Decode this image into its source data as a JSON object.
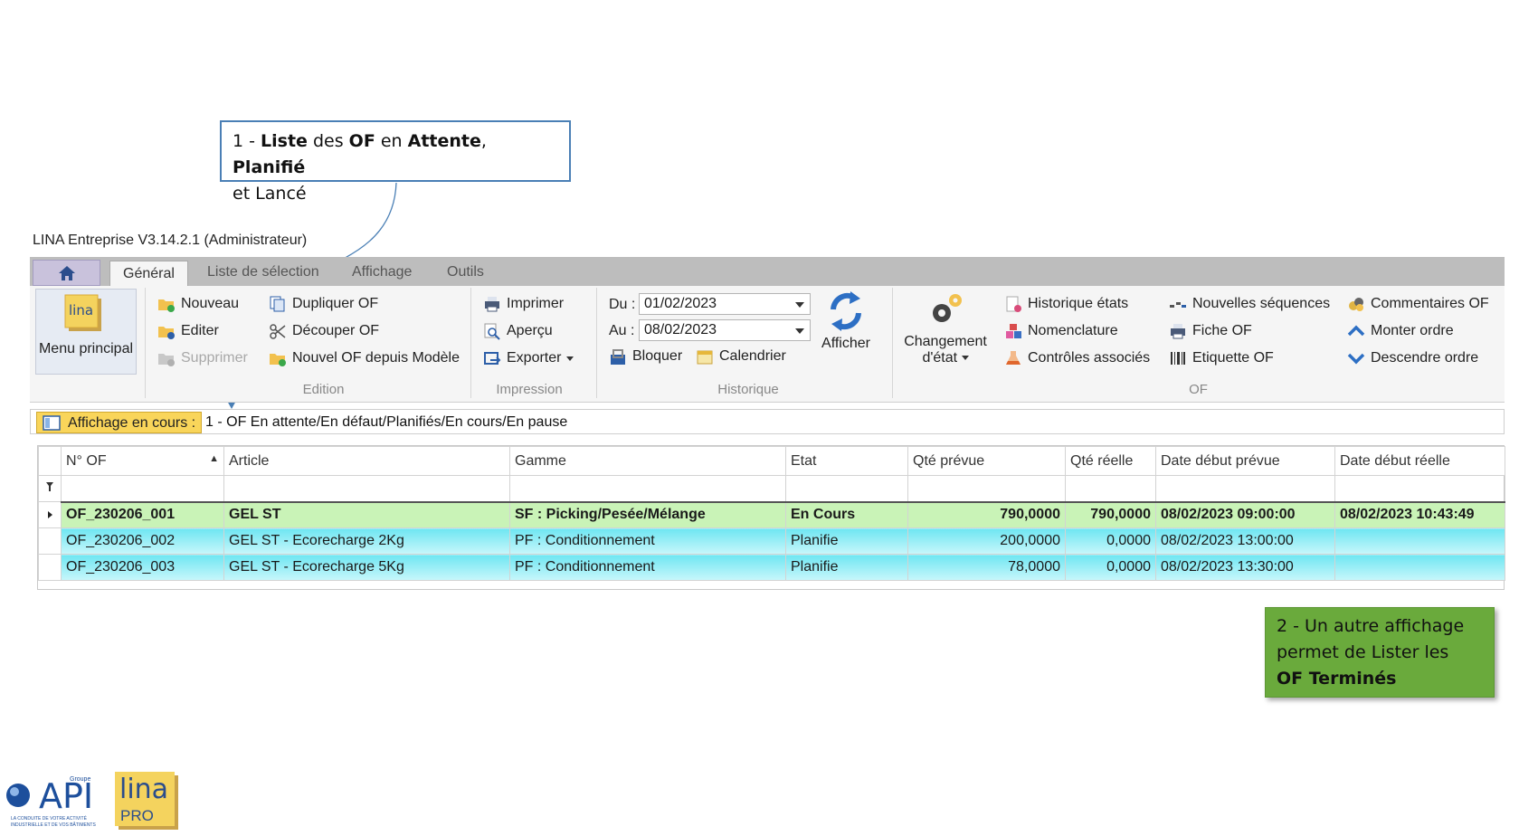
{
  "callout1": {
    "num": "1 - ",
    "w1": "Liste",
    "w2": " des ",
    "w3": "OF",
    "w4": " en ",
    "w5": "Attente",
    "w6": ", ",
    "w7": "Planifié",
    "w8": "et Lancé"
  },
  "callout2": {
    "line1": "2 - Un autre affichage",
    "line2": "permet de Lister les",
    "line3": "OF Terminés"
  },
  "window": {
    "title": "LINA Entreprise  V3.14.2.1  (Administrateur)"
  },
  "tabs": [
    "Général",
    "Liste de sélection",
    "Affichage",
    "Outils"
  ],
  "ribbon": {
    "menu_principal": "Menu principal",
    "edition": {
      "label": "Edition",
      "nouveau": "Nouveau",
      "editer": "Editer",
      "supprimer": "Supprimer",
      "dupliquer": "Dupliquer OF",
      "decouper": "Découper OF",
      "nouvel_modele": "Nouvel OF depuis Modèle"
    },
    "impression": {
      "label": "Impression",
      "imprimer": "Imprimer",
      "apercu": "Aperçu",
      "exporter": "Exporter"
    },
    "historique": {
      "label": "Historique",
      "du_label": "Du :",
      "du_value": "01/02/2023",
      "au_label": "Au :",
      "au_value": "08/02/2023",
      "bloquer": "Bloquer",
      "calendrier": "Calendrier",
      "afficher": "Afficher"
    },
    "of": {
      "label": "OF",
      "changement": "Changement",
      "detat": "d'état",
      "historique_etats": "Historique états",
      "nomenclature": "Nomenclature",
      "controles": "Contrôles associés",
      "nouvelles_sequences": "Nouvelles séquences",
      "fiche_of": "Fiche OF",
      "etiquette_of": "Etiquette OF",
      "commentaires": "Commentaires OF",
      "monter": "Monter ordre",
      "descendre": "Descendre ordre"
    }
  },
  "affichage": {
    "label": "Affichage en cours :",
    "value": "1 - OF En attente/En défaut/Planifiés/En cours/En pause"
  },
  "grid": {
    "columns": [
      "N° OF",
      "Article",
      "Gamme",
      "Etat",
      "Qté prévue",
      "Qté réelle",
      "Date début prévue",
      "Date début réelle"
    ],
    "rows": [
      [
        "OF_230206_001",
        "GEL ST",
        "SF : Picking/Pesée/Mélange",
        "En Cours",
        "790,0000",
        "790,0000",
        "08/02/2023 09:00:00",
        "08/02/2023 10:43:49"
      ],
      [
        "OF_230206_002",
        "GEL ST - Ecorecharge 2Kg",
        "PF : Conditionnement",
        "Planifie",
        "200,0000",
        "0,0000",
        "08/02/2023 13:00:00",
        ""
      ],
      [
        "OF_230206_003",
        "GEL ST - Ecorecharge 5Kg",
        "PF : Conditionnement",
        "Planifie",
        "78,0000",
        "0,0000",
        "08/02/2023 13:30:00",
        ""
      ]
    ]
  },
  "logos": {
    "api": "API",
    "groupe": "Groupe",
    "api_tagline": "LA CONDUITE DE VOTRE ACTIVITÉ INDUSTRIELLE ET DE VOS BÂTIMENTS",
    "lina": "lina",
    "pro": "PRO"
  },
  "colors": {
    "callout1_border": "#4a7fb5",
    "callout2_bg": "#6aaa3c",
    "row_active": "#c9f3b7",
    "row_planned": "#6ee6f2",
    "affichage_label": "#f9d55a"
  }
}
